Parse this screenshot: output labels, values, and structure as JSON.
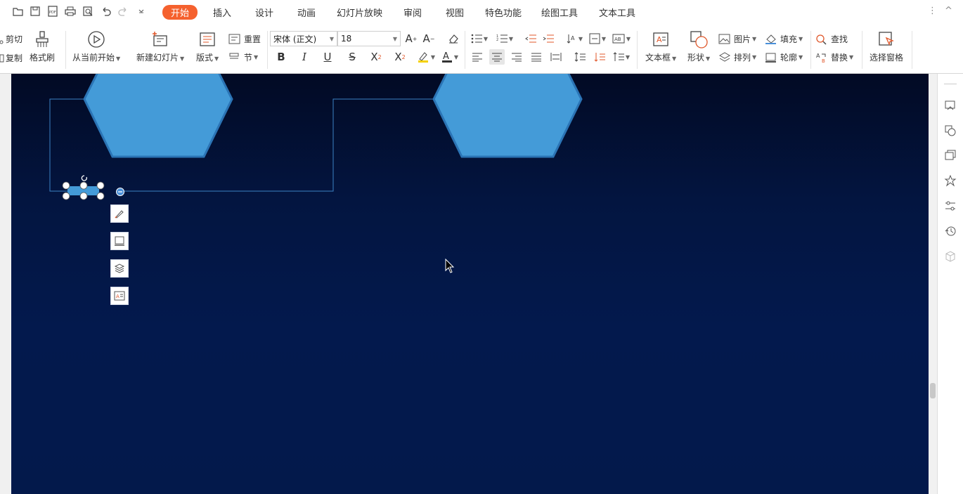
{
  "menu": {
    "tabs": [
      "开始",
      "插入",
      "设计",
      "动画",
      "幻灯片放映",
      "审阅",
      "视图",
      "特色功能",
      "绘图工具",
      "文本工具"
    ],
    "active_tab": "开始",
    "more_label": "⋮",
    "collapse_label": "^"
  },
  "quick_access": [
    "open-icon",
    "save-icon",
    "pdf-icon",
    "print-icon",
    "print-preview-icon",
    "undo-icon",
    "redo-icon",
    "customize-icon"
  ],
  "ribbon": {
    "cut": "剪切",
    "copy": "复制",
    "format_painter": "格式刷",
    "from_current": "从当前开始",
    "new_slide": "新建幻灯片",
    "layout": "版式",
    "reset": "重置",
    "section": "节",
    "font_name": "宋体 (正文)",
    "font_size": "18",
    "text_box": "文本框",
    "shape": "形状",
    "picture": "图片",
    "fill": "填充",
    "arrange": "排列",
    "outline": "轮廓",
    "find": "查找",
    "replace": "替换",
    "select_pane": "选择窗格"
  },
  "colors": {
    "active_tab": "#f5612e",
    "slide_top": "#020a24",
    "slide_bottom": "#03194b",
    "hexagon_fill": "#449bd8",
    "hexagon_stroke": "#2b74b5",
    "connector": "#3b82c4"
  },
  "side_panel_icons": [
    "slides-icon",
    "shapes-icon",
    "copy-format-icon",
    "star-icon",
    "settings-sliders-icon",
    "history-icon",
    "package-icon"
  ],
  "float_toolbar_icons": [
    "style-brush-icon",
    "outline-icon",
    "layers-icon",
    "text-box-icon"
  ]
}
